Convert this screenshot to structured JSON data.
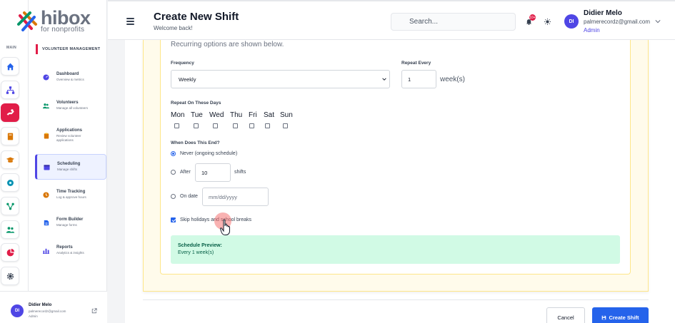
{
  "app": {
    "logo_main": "hibox",
    "logo_sub": "for nonprofits",
    "rail_section": "MAIN",
    "sidebar_section": "VOLUNTEER MANAGEMENT"
  },
  "sidebar": {
    "items": [
      {
        "label": "Dashboard",
        "sub": "Overview & metrics",
        "icon": "dashboard-icon",
        "color": "#4f46e5"
      },
      {
        "label": "Volunteers",
        "sub": "Manage all volunteers",
        "icon": "users-icon",
        "color": "#059669"
      },
      {
        "label": "Applications",
        "sub": "Review volunteer applications",
        "icon": "clipboard-icon",
        "color": "#d97706"
      },
      {
        "label": "Scheduling",
        "sub": "Manage shifts",
        "icon": "calendar-icon",
        "color": "#4f46e5",
        "active": true
      },
      {
        "label": "Time Tracking",
        "sub": "Log & approve hours",
        "icon": "clock-icon",
        "color": "#d97706"
      },
      {
        "label": "Form Builder",
        "sub": "Manage forms",
        "icon": "document-icon",
        "color": "#2563eb"
      },
      {
        "label": "Reports",
        "sub": "Analytics & insights",
        "icon": "bar-chart-icon",
        "color": "#4f46e5"
      }
    ],
    "user": {
      "initials": "DI",
      "name": "Didier Melo",
      "email": "palmerecordz@gmail.com",
      "role": "Admin"
    }
  },
  "header": {
    "title": "Create New Shift",
    "subtitle": "Welcome back!",
    "search_placeholder": "Search...",
    "notification_count": "10+",
    "user_initials": "DI",
    "user_name": "Didier Melo",
    "user_email": "palmerecordz@gmail.com",
    "user_role": "Admin"
  },
  "form": {
    "recurring_note": "Recurring options are shown below.",
    "frequency_label": "Frequency",
    "frequency_value": "Weekly",
    "repeat_every_label": "Repeat Every",
    "repeat_every_value": "1",
    "repeat_every_unit": "week(s)",
    "repeat_days_label": "Repeat On These Days",
    "days": [
      "Mon",
      "Tue",
      "Wed",
      "Thu",
      "Fri",
      "Sat",
      "Sun"
    ],
    "end_label": "When Does This End?",
    "end_never": "Never (ongoing schedule)",
    "end_after": "After",
    "end_after_value": "10",
    "end_after_unit": "shifts",
    "end_on_date": "On date",
    "end_date_placeholder": "mm/dd/yyyy",
    "skip_holidays": "Skip holidays and school breaks",
    "preview_title": "Schedule Preview:",
    "preview_text": "Every 1 week(s)"
  },
  "actions": {
    "cancel": "Cancel",
    "create": "Create Shift"
  },
  "colors": {
    "accent": "#e11d48",
    "primary": "#2563eb",
    "preview_bg": "#d1fae5",
    "card_bg": "#fffbeb"
  }
}
